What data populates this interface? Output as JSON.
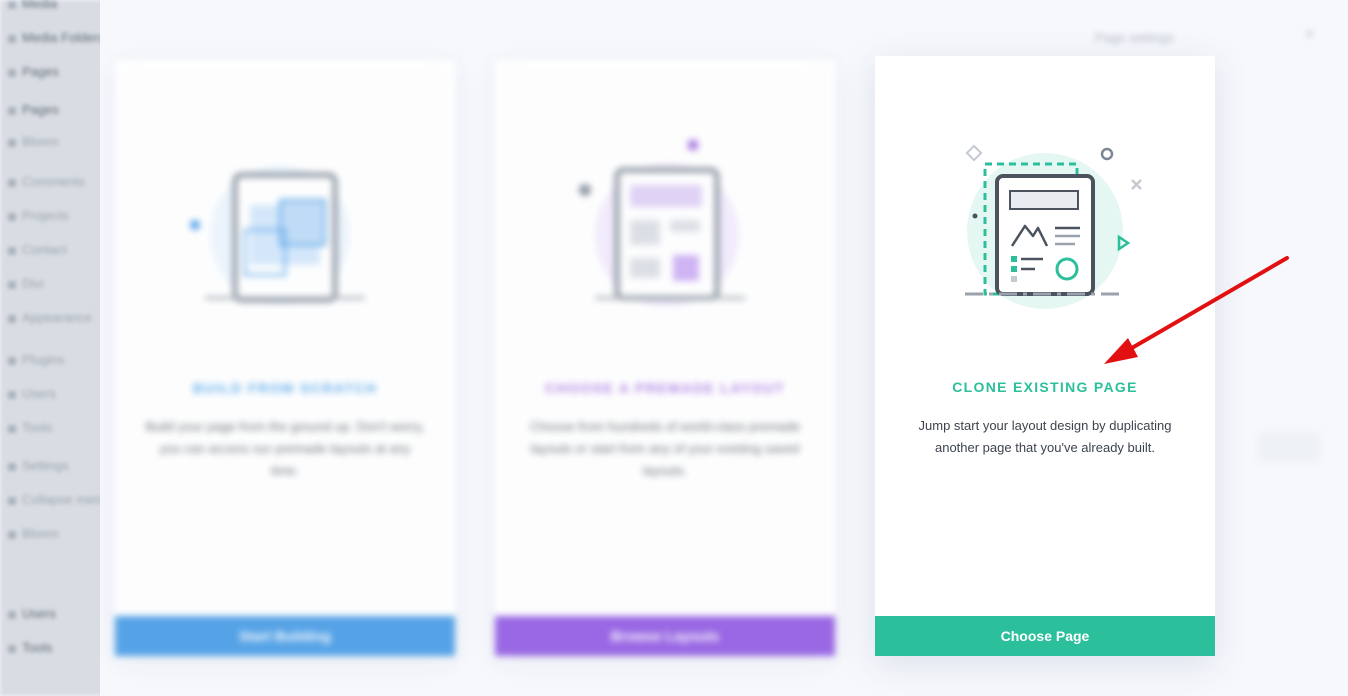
{
  "sidebar": {
    "items": [
      {
        "label": "Media"
      },
      {
        "label": "Media Folders"
      },
      {
        "label": "Pages"
      },
      {
        "label": "Pages"
      },
      {
        "label": "Bloom"
      },
      {
        "label": "Comments"
      },
      {
        "label": "Projects"
      },
      {
        "label": "Contact"
      },
      {
        "label": "Divi"
      },
      {
        "label": "Appearance"
      },
      {
        "label": "Plugins"
      },
      {
        "label": "Users"
      },
      {
        "label": "Tools"
      },
      {
        "label": "Settings"
      },
      {
        "label": "Collapse menu"
      },
      {
        "label": "Bloom"
      },
      {
        "label": "Users"
      },
      {
        "label": "Tools"
      }
    ]
  },
  "modal": {
    "header_label": "Page settings",
    "close_glyph": "×"
  },
  "cards": [
    {
      "title": "BUILD FROM SCRATCH",
      "description": "Build your page from the ground up. Don't worry, you can access our premade layouts at any time.",
      "button_label": "Start Building",
      "accent": "#3a94e3"
    },
    {
      "title": "CHOOSE A PREMADE LAYOUT",
      "description": "Choose from hundreds of world-class premade layouts or start from any of your existing saved layouts.",
      "button_label": "Browse Layouts",
      "accent": "#8a4fe0"
    },
    {
      "title": "CLONE EXISTING PAGE",
      "description": "Jump start your layout design by duplicating another page that you've already built.",
      "button_label": "Choose Page",
      "accent": "#2bbf9c"
    }
  ],
  "annotation": {
    "arrow_color": "#e21010",
    "icon": "red-arrow"
  }
}
